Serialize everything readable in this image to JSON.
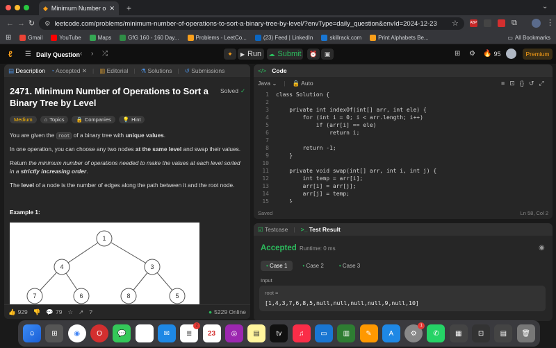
{
  "browser": {
    "tab_title": "Minimum Number of Operatio",
    "url": "leetcode.com/problems/minimum-number-of-operations-to-sort-a-binary-tree-by-level/?envType=daily_question&envId=2024-12-23",
    "bookmarks": [
      "Gmail",
      "YouTube",
      "Maps",
      "GfG 160 - 160 Day...",
      "Problems - LeetCo...",
      "(23) Feed | LinkedIn",
      "skillrack.com",
      "Print Alphabets Be..."
    ],
    "all_bookmarks": "All Bookmarks",
    "bookmark_colors": [
      "#ea4335",
      "#ff0000",
      "#34a853",
      "#2f8d46",
      "#f89f1b",
      "#0a66c2",
      "#1976d2",
      "#f89f1b"
    ]
  },
  "nav": {
    "daily": "Daily Question",
    "run": "Run",
    "submit": "Submit",
    "streak": "95",
    "premium": "Premium"
  },
  "left_tabs": [
    "Description",
    "Accepted",
    "Editorial",
    "Solutions",
    "Submissions"
  ],
  "problem": {
    "title": "2471. Minimum Number of Operations to Sort a Binary Tree by Level",
    "status": "Solved",
    "difficulty": "Medium",
    "tags": [
      "Topics",
      "Companies",
      "Hint"
    ],
    "p1_a": "You are given the ",
    "p1_code": "root",
    "p1_b": " of a binary tree with ",
    "p1_bold": "unique values",
    "p2_a": "In one operation, you can choose any two nodes ",
    "p2_bold": "at the same level",
    "p2_b": " and swap their values.",
    "p3_a": "Return ",
    "p3_it": "the minimum number of operations needed to make the values at each level sorted in a ",
    "p3_bi": "strictly increasing order",
    "p4_bold": "level",
    "p4_b": " of a node is the number of edges along the path between it and the root node.",
    "p4_a": "The ",
    "example": "Example 1:",
    "tree_nodes": [
      "1",
      "4",
      "3",
      "7",
      "6",
      "8",
      "5"
    ]
  },
  "footer_left": {
    "likes": "929",
    "comments": "79",
    "online": "5229 Online"
  },
  "code_panel": {
    "title": "Code",
    "lang": "Java",
    "auto": "Auto",
    "saved": "Saved",
    "pos": "Ln 58, Col 2",
    "lines": [
      "class Solution {",
      "",
      "    private int indexOf(int[] arr, int ele) {",
      "        for (int i = 0; i < arr.length; i++)",
      "            if (arr[i] == ele)",
      "                return i;",
      "",
      "        return -1;",
      "    }",
      "",
      "    private void swap(int[] arr, int i, int j) {",
      "        int temp = arr[i];",
      "        arr[i] = arr[j];",
      "        arr[j] = temp;",
      "    }"
    ]
  },
  "result": {
    "tab1": "Testcase",
    "tab2": "Test Result",
    "status": "Accepted",
    "runtime": "Runtime: 0 ms",
    "cases": [
      "Case 1",
      "Case 2",
      "Case 3"
    ],
    "input": "Input",
    "var": "root =",
    "value": "[1,4,3,7,6,8,5,null,null,null,null,9,null,10]"
  },
  "dock_badges": {
    "reminders": "2",
    "settings": "1"
  }
}
